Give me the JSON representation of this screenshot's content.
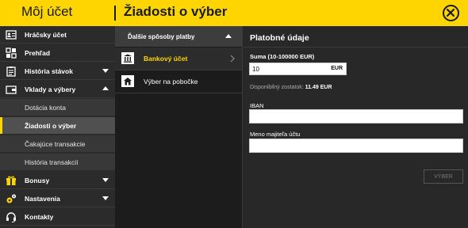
{
  "header": {
    "account_title": "Môj účet",
    "page_title": "Žiadosti o výber"
  },
  "sidebar": {
    "items": [
      {
        "label": "Hráčsky účet",
        "icon": "id-card-icon"
      },
      {
        "label": "Prehľad",
        "icon": "grid-icon"
      },
      {
        "label": "História stávok",
        "icon": "history-icon"
      },
      {
        "label": "Vklady a výbery",
        "icon": "wallet-icon"
      },
      {
        "label": "Bonusy",
        "icon": "gift-icon"
      },
      {
        "label": "Nastavenia",
        "icon": "gears-icon"
      },
      {
        "label": "Kontakty",
        "icon": "headset-icon"
      }
    ],
    "subitems": [
      {
        "label": "Dotácia konta"
      },
      {
        "label": "Žiadosti o výber"
      },
      {
        "label": "Čakajúce transakcie"
      },
      {
        "label": "História transakcií"
      }
    ]
  },
  "methods": {
    "header_label": "Ďalšie spôsoby platby",
    "items": [
      {
        "label": "Bankový účet",
        "icon": "bank-icon"
      },
      {
        "label": "Výber na pobočke",
        "icon": "branch-icon"
      }
    ]
  },
  "form": {
    "title": "Platobné údaje",
    "amount_label": "Suma (10-100000 EUR)",
    "amount_value": "10",
    "currency": "EUR",
    "available_label": "Disponibilný zostatok:",
    "available_value": "11.49 EUR",
    "iban_label": "IBAN",
    "iban_value": "",
    "owner_label": "Meno majiteľa účtu",
    "owner_value": "",
    "submit_label": "VÝBER"
  },
  "colors": {
    "accent": "#ffd500",
    "sidebar_bg": "#2b2b2b",
    "panel_bg": "#1c1c1c"
  }
}
